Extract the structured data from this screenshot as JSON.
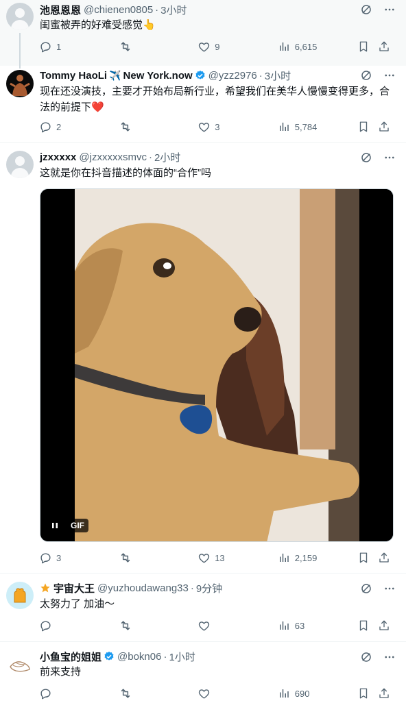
{
  "posts": [
    {
      "name": "池恩恩恩",
      "handle": "@chienen0805",
      "time": "3小时",
      "text": "闺蜜被弄的好难受感觉👆",
      "replies": "1",
      "likes": "9",
      "views": "6,615"
    },
    {
      "name": "Tommy HaoLi",
      "location": "New York.now",
      "handle": "@yzz2976",
      "time": "3小时",
      "text": "现在还没演技，主要才开始布局新行业，希望我们在美华人慢慢变得更多，合法的前提下❤️",
      "replies": "2",
      "likes": "3",
      "views": "5,784"
    },
    {
      "name": "jzxxxxx",
      "handle": "@jzxxxxxsmvc",
      "time": "2小时",
      "text": "这就是你在抖音描述的体面的“合作”吗",
      "media_label": "GIF",
      "replies": "3",
      "likes": "13",
      "views": "2,159"
    },
    {
      "name": "宇宙大王",
      "handle": "@yuzhoudawang33",
      "time": "9分钟",
      "text": "太努力了 加油～",
      "replies": "",
      "likes": "",
      "views": "63"
    },
    {
      "name": "小鱼宝的姐姐",
      "handle": "@bokn06",
      "time": "1小时",
      "text": "前来支持",
      "replies": "",
      "likes": "",
      "views": "690"
    }
  ],
  "separator": "·",
  "colors": {
    "accent": "#1d9bf0",
    "muted": "#536471",
    "heart": "#f91880"
  },
  "icons": [
    "grok-icon",
    "more-icon",
    "reply-icon",
    "retweet-icon",
    "like-icon",
    "views-icon",
    "bookmark-icon",
    "share-icon",
    "verified-icon",
    "pause-icon"
  ]
}
